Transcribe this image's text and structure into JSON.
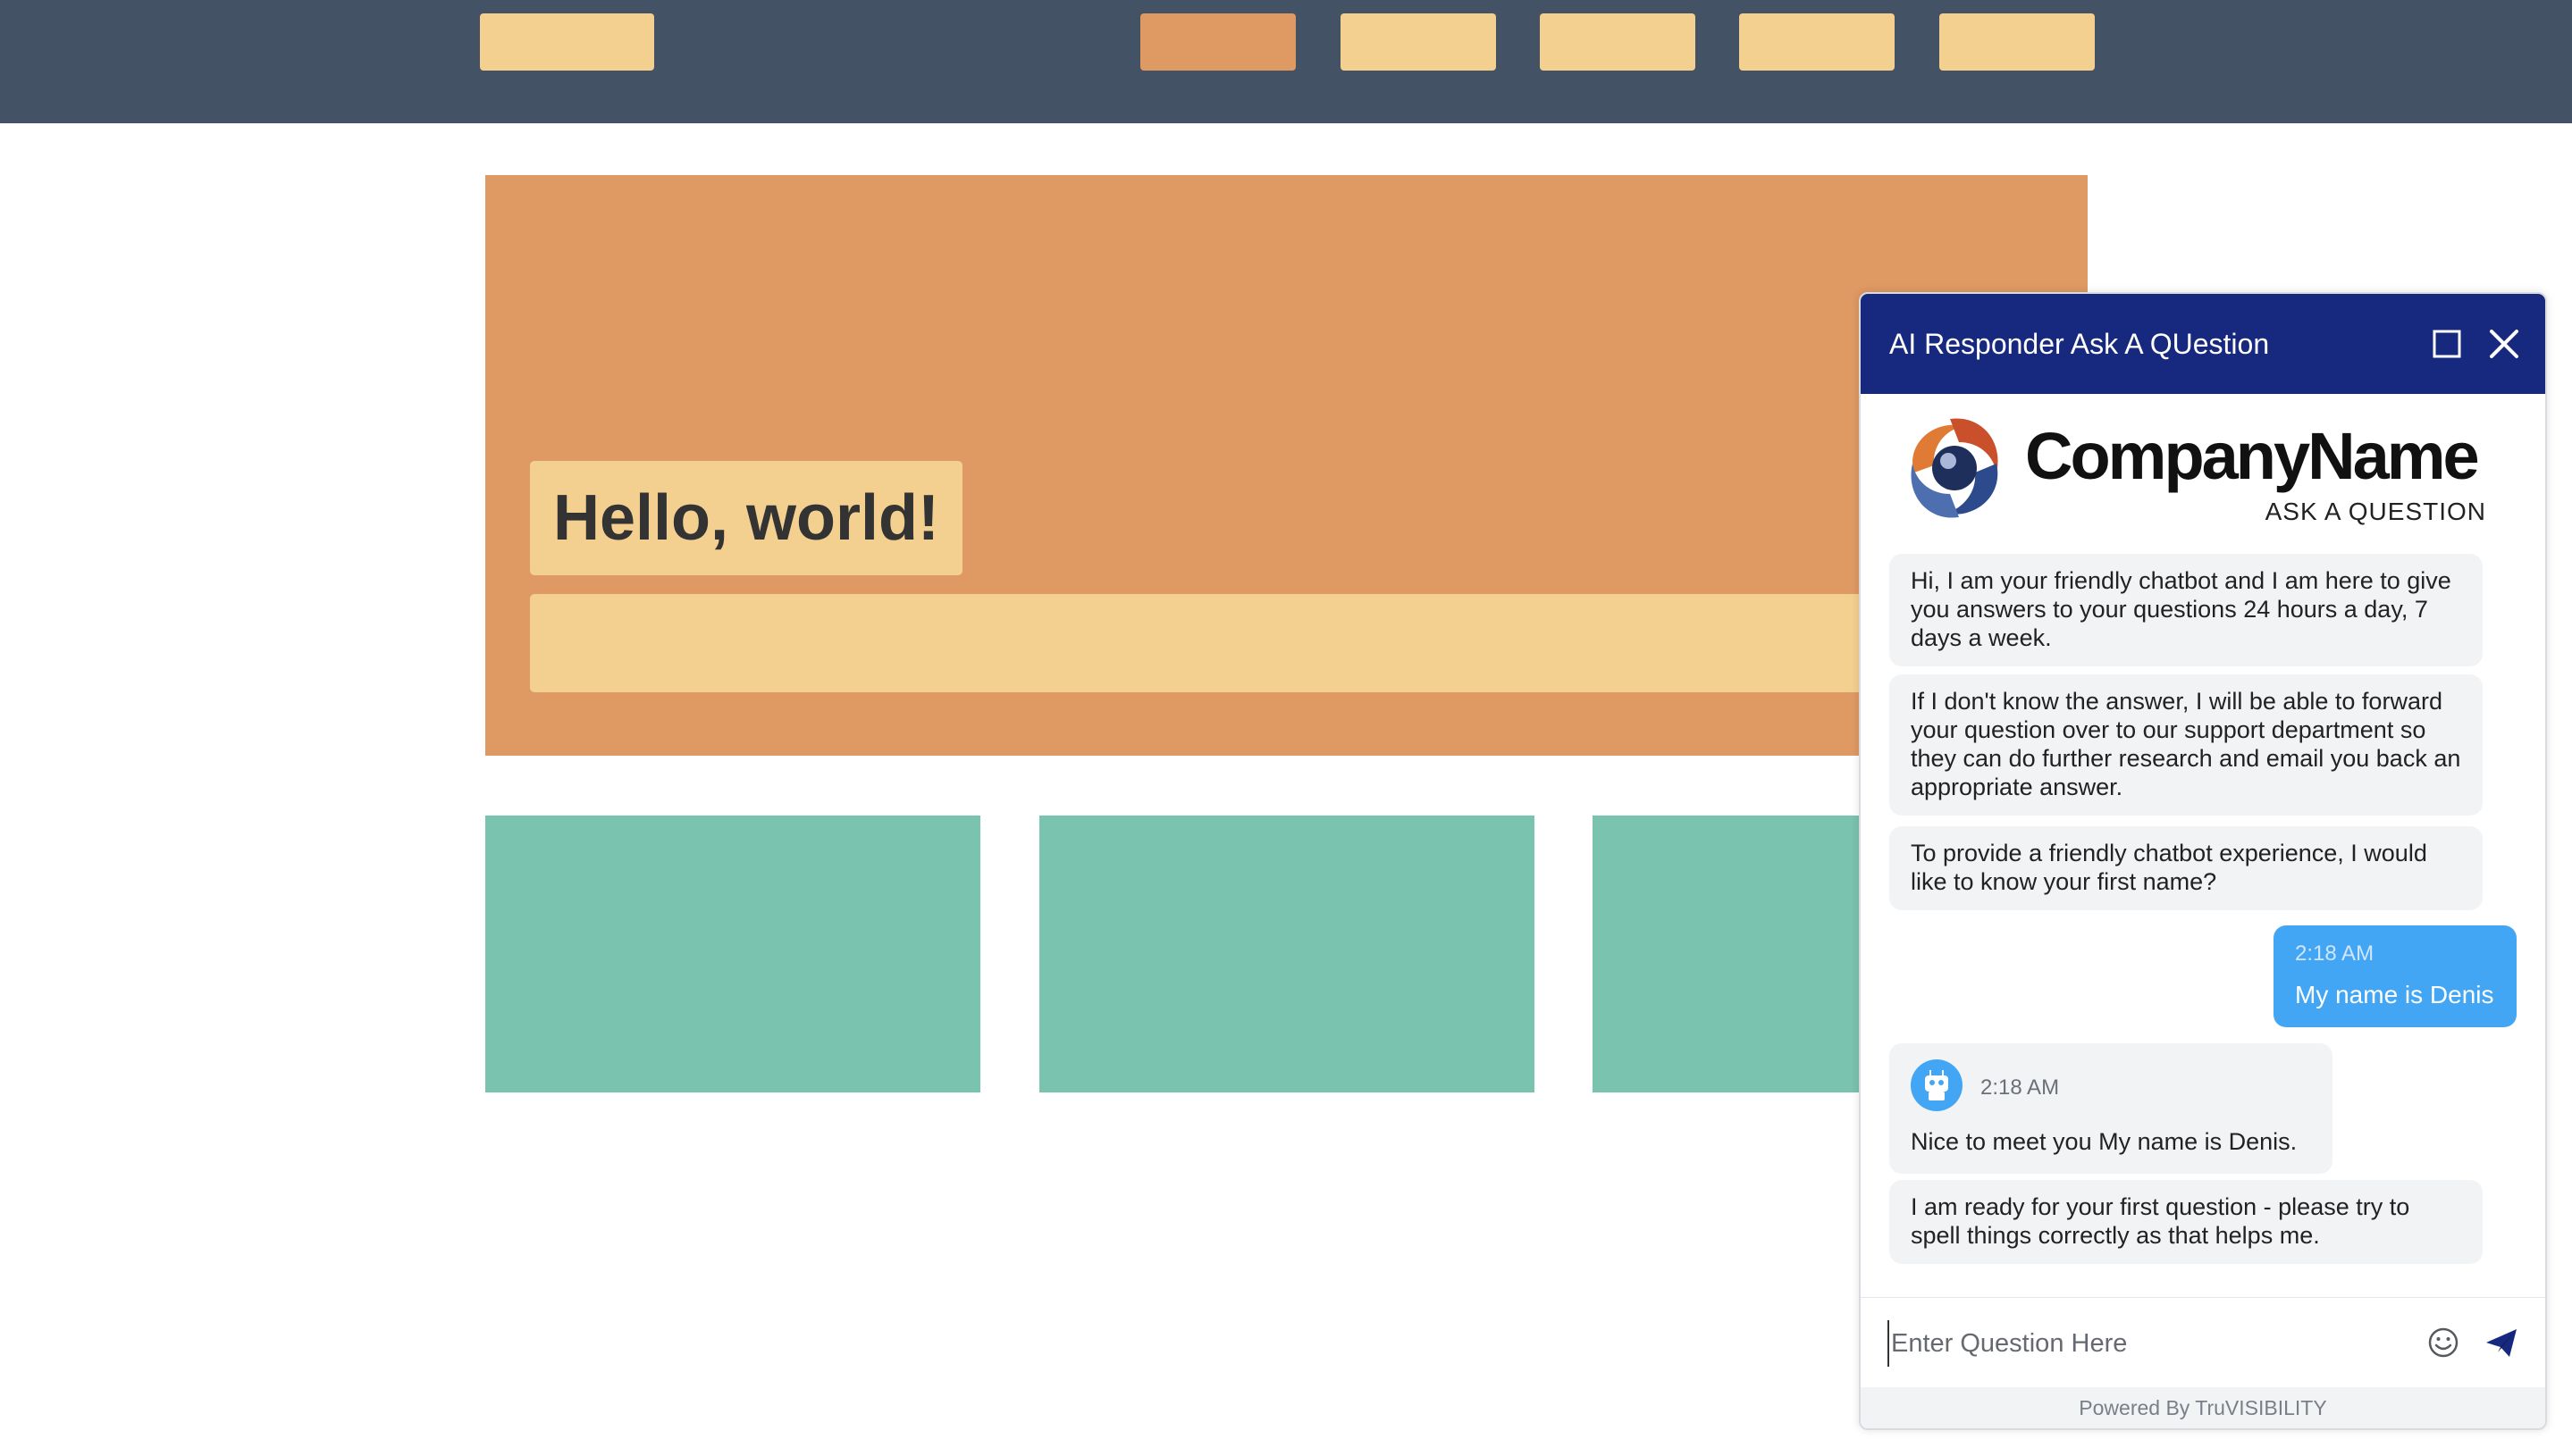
{
  "hero": {
    "heading": "Hello, world!"
  },
  "chat": {
    "title": "AI Responder Ask A QUestion",
    "brand": {
      "name": "CompanyName",
      "tagline": "ASK A QUESTION"
    },
    "messages": [
      {
        "from": "bot",
        "text": "Hi, I am your friendly chatbot and I am here to give you answers to your questions 24 hours a day, 7 days a week."
      },
      {
        "from": "bot",
        "text": "If I don't know the answer, I will be able to forward your question over to our support department so they can do further research and email you back an appropriate answer."
      },
      {
        "from": "bot",
        "text": "To provide a friendly chatbot experience, I would like to know your first name?"
      },
      {
        "from": "user",
        "time": "2:18 AM",
        "text": "My name is Denis"
      },
      {
        "from": "bot",
        "time": "2:18 AM",
        "text": "Nice to meet you My name is Denis."
      },
      {
        "from": "bot",
        "text": "I am ready for your first question - please try to spell things correctly as that helps me."
      }
    ],
    "input": {
      "placeholder": "Enter Question Here",
      "value": ""
    },
    "footer": "Powered By TruVISIBILITY"
  },
  "icons": {
    "maximize": "square-outline-icon",
    "close": "close-x-icon",
    "emoji": "smiley-icon",
    "send": "paper-plane-icon",
    "bot_avatar": "robot-icon"
  },
  "colors": {
    "nav_bg": "#435264",
    "nav_item": "#f3d08f",
    "nav_item_active": "#df9963",
    "hero_bg": "#df9963",
    "card": "#7ac3af",
    "chat_header": "#16297f",
    "user_bubble": "#43a6f4",
    "bot_bubble": "#f2f3f5"
  }
}
